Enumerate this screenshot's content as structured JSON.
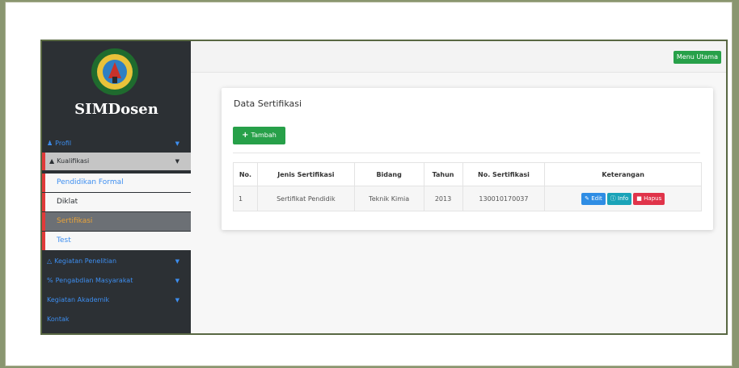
{
  "sidebar": {
    "brand": "SIMDosen",
    "items": {
      "profil": "Profil",
      "kualifikasi": "Kualifikasi",
      "pendidikan_formal": "Pendidikan Formal",
      "diklat": "Diklat",
      "sertifikasi": "Sertifikasi",
      "test": "Test",
      "kegiatan_penelitian": "Kegiatan Penelitian",
      "pengabdian": "Pengabdian Masyarakat",
      "kegiatan_akademik": "Kegiatan Akademik",
      "kontak": "Kontak"
    }
  },
  "topbar": {
    "menu_button": "Menu Utama"
  },
  "content": {
    "title": "Data Sertifikasi",
    "add_button": "Tambah",
    "table": {
      "headers": [
        "No.",
        "Jenis Sertifikasi",
        "Bidang",
        "Tahun",
        "No. Sertifikasi",
        "Keterangan"
      ],
      "rows": [
        {
          "no": "1",
          "jenis": "Sertifikat Pendidik",
          "bidang": "Teknik Kimia",
          "tahun": "2013",
          "nomor": "130010170037"
        }
      ],
      "actions": {
        "edit": "Edit",
        "info": "Info",
        "hapus": "Hapus"
      }
    }
  },
  "colors": {
    "sidebar_bg": "#2c3034",
    "accent_green": "#27a049",
    "link_blue": "#3d8ef0",
    "active_orange": "#e8a33a",
    "marker_red": "#e03a3a"
  },
  "icons": [
    "logo-emblem",
    "user-icon",
    "graduation-cap-icon",
    "caret-down-icon",
    "flask-icon",
    "share-icon",
    "plus-icon",
    "edit-icon",
    "info-icon",
    "trash-icon"
  ]
}
